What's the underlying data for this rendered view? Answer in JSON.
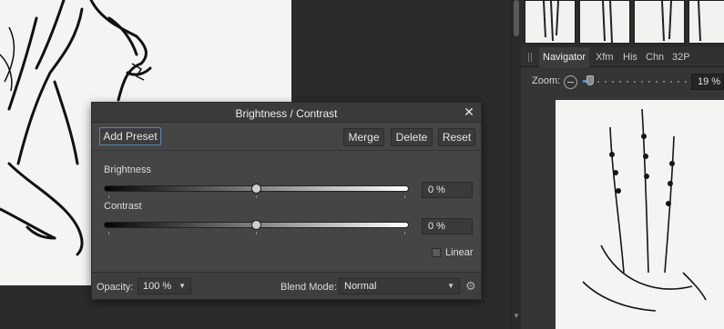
{
  "dialog": {
    "title": "Brightness / Contrast",
    "add_preset_label": "Add Preset",
    "merge_label": "Merge",
    "delete_label": "Delete",
    "reset_label": "Reset",
    "brightness_label": "Brightness",
    "brightness_value": "0 %",
    "contrast_label": "Contrast",
    "contrast_value": "0 %",
    "linear_label": "Linear",
    "opacity_label": "Opacity:",
    "opacity_value": "100 %",
    "blend_mode_label": "Blend Mode:",
    "blend_mode_value": "Normal"
  },
  "panel": {
    "tabs": [
      "Navigator",
      "Xfm",
      "His",
      "Chn",
      "32P"
    ],
    "active_tab": "Navigator",
    "zoom_label": "Zoom:",
    "zoom_value": "19 %"
  },
  "icons": {
    "close": "close-icon",
    "gear": "gear-icon",
    "zoom_out": "zoom-out-icon",
    "dropdown": "chevron-down-icon"
  },
  "colors": {
    "accent": "#4a8fd8",
    "dialog_bg": "#454545"
  }
}
